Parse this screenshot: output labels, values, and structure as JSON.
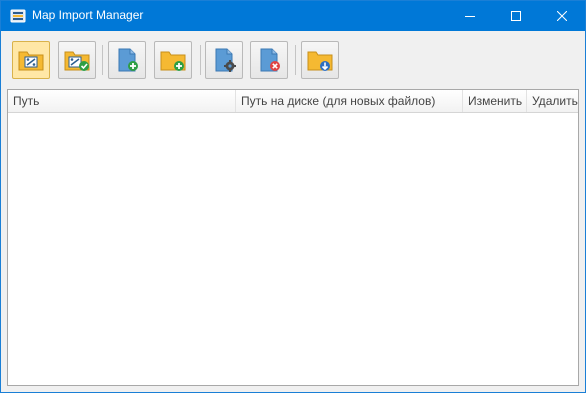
{
  "window": {
    "title": "Map Import Manager"
  },
  "toolbar": {
    "buttons": [
      {
        "name": "open-map-folder",
        "icon": "folder-map-icon"
      },
      {
        "name": "validate-map",
        "icon": "folder-map-check-icon"
      },
      {
        "name": "add-file",
        "icon": "file-add-icon"
      },
      {
        "name": "add-folder",
        "icon": "folder-add-icon"
      },
      {
        "name": "file-settings",
        "icon": "file-gear-icon"
      },
      {
        "name": "remove-file",
        "icon": "file-remove-icon"
      },
      {
        "name": "download-folder",
        "icon": "folder-download-icon"
      }
    ]
  },
  "grid": {
    "columns": [
      "Путь",
      "Путь на диске (для новых файлов)",
      "Изменить",
      "Удалить"
    ],
    "rows": []
  },
  "colors": {
    "titlebar": "#0078d7",
    "folder": "#f5b932",
    "file": "#5b9bd5",
    "add": "#2e9e44",
    "remove": "#e04343",
    "active_button": "#ffe7a6"
  }
}
